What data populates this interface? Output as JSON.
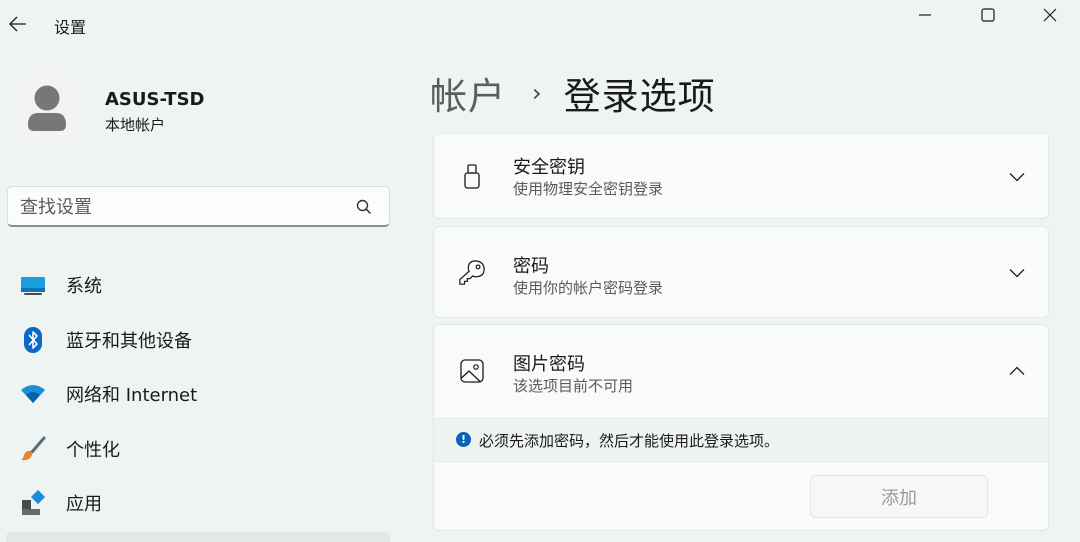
{
  "window": {
    "app_title": "设置"
  },
  "profile": {
    "name": "ASUS-TSD",
    "account_type": "本地帐户"
  },
  "search": {
    "placeholder": "查找设置"
  },
  "sidebar": {
    "items": [
      {
        "label": "系统",
        "icon": "system-display-icon"
      },
      {
        "label": "蓝牙和其他设备",
        "icon": "bluetooth-icon"
      },
      {
        "label": "网络和 Internet",
        "icon": "wifi-icon"
      },
      {
        "label": "个性化",
        "icon": "paintbrush-icon"
      },
      {
        "label": "应用",
        "icon": "apps-icon"
      }
    ]
  },
  "breadcrumb": {
    "parent": "帐户",
    "separator": "›",
    "current": "登录选项"
  },
  "options": [
    {
      "title": "安全密钥",
      "subtitle": "使用物理安全密钥登录",
      "icon": "usb-key-icon",
      "expanded": false
    },
    {
      "title": "密码",
      "subtitle": "使用你的帐户密码登录",
      "icon": "key-icon",
      "expanded": false
    },
    {
      "title": "图片密码",
      "subtitle": "该选项目前不可用",
      "icon": "picture-icon",
      "expanded": true
    }
  ],
  "picture_password": {
    "info_message": "必须先添加密码，然后才能使用此登录选项。",
    "add_button_label": "添加",
    "add_button_enabled": false
  },
  "colors": {
    "background": "#eef4f2",
    "card": "#f9fbfa",
    "info_icon": "#0a5fb6",
    "bluetooth": "#0a68c8",
    "wifi": "#1b8fd6"
  }
}
